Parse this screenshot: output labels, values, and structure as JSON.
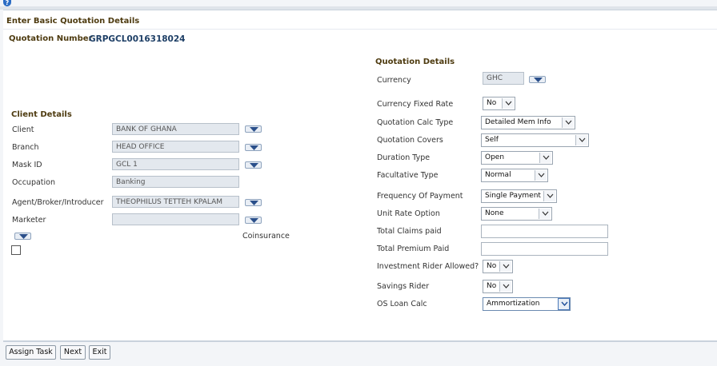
{
  "header": {
    "title": "Enter Basic Quotation Details"
  },
  "quotation": {
    "number_label": "Quotation Number",
    "number_value": "GRPGCL0016318024"
  },
  "client_details": {
    "heading": "Client Details",
    "fields": [
      {
        "label": "Client",
        "value": "BANK OF GHANA"
      },
      {
        "label": "Branch",
        "value": "HEAD OFFICE"
      },
      {
        "label": "Mask ID",
        "value": "GCL 1"
      },
      {
        "label": "Occupation",
        "value": "Banking"
      },
      {
        "label": "Agent/Broker/Introducer",
        "value": "THEOPHILUS TETTEH KPALAM"
      },
      {
        "label": "Marketer",
        "value": ""
      }
    ],
    "coinsurance_label": "Coinsurance"
  },
  "quotation_details": {
    "heading": "Quotation Details",
    "currency": {
      "label": "Currency",
      "value": "GHC"
    },
    "currency_fixed_rate": {
      "label": "Currency Fixed Rate",
      "value": "No"
    },
    "calc_type": {
      "label": "Quotation Calc Type",
      "value": "Detailed Mem Info"
    },
    "covers": {
      "label": "Quotation Covers",
      "value": "Self"
    },
    "duration_type": {
      "label": "Duration Type",
      "value": "Open"
    },
    "facultative_type": {
      "label": "Facultative Type",
      "value": "Normal"
    },
    "frequency": {
      "label": "Frequency Of Payment",
      "value": "Single Payment"
    },
    "unit_rate": {
      "label": "Unit Rate Option",
      "value": "None"
    },
    "total_claims": {
      "label": "Total Claims paid",
      "value": ""
    },
    "total_premium": {
      "label": "Total Premium Paid",
      "value": ""
    },
    "investment_rider": {
      "label": "Investment Rider Allowed?",
      "value": "No"
    },
    "savings_rider": {
      "label": "Savings Rider",
      "value": "No"
    },
    "os_loan_calc": {
      "label": "OS Loan Calc",
      "value": "Ammortization"
    }
  },
  "footer": {
    "assign_task": "Assign Task",
    "next": "Next",
    "exit": "Exit"
  },
  "icons": {
    "help": "help-icon",
    "lov": "dropdown-arrow-icon",
    "select": "chevron-down-icon"
  },
  "colors": {
    "heading": "#4e3b10",
    "quotation_number": "#1e3f66",
    "lov_arrow": "#2a4f8a"
  }
}
